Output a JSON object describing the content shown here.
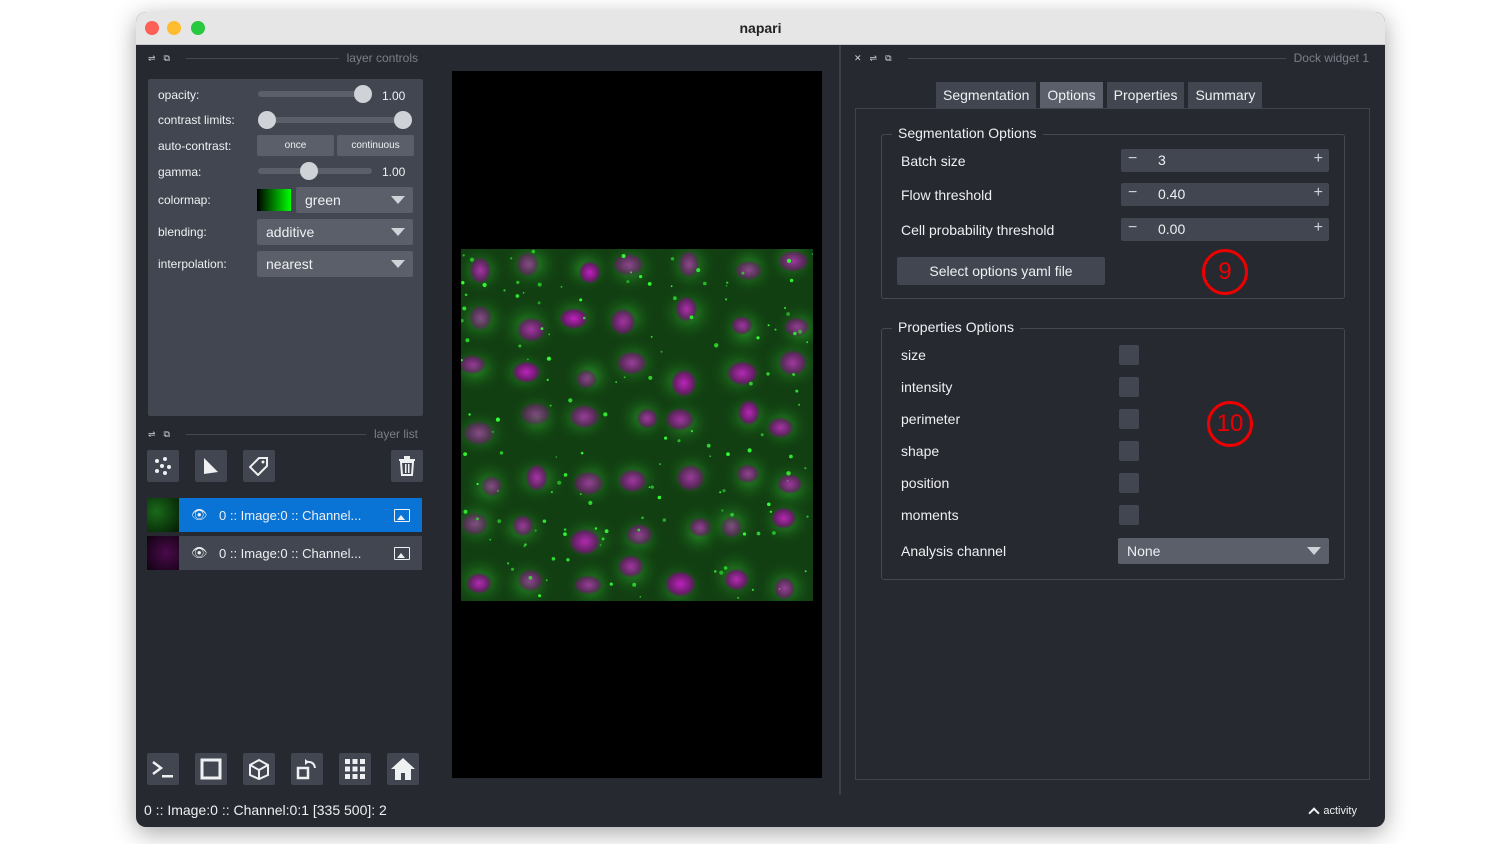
{
  "window": {
    "title": "napari"
  },
  "left_dock": {
    "header": "layer controls",
    "controls": {
      "opacity_label": "opacity:",
      "opacity_value": "1.00",
      "opacity_fraction": 1.0,
      "contrast_label": "contrast limits:",
      "auto_contrast_label": "auto-contrast:",
      "once_label": "once",
      "continuous_label": "continuous",
      "gamma_label": "gamma:",
      "gamma_value": "1.00",
      "colormap_label": "colormap:",
      "colormap_value": "green",
      "blending_label": "blending:",
      "blending_value": "additive",
      "interpolation_label": "interpolation:",
      "interpolation_value": "nearest"
    },
    "layer_list_header": "layer list",
    "layers": [
      {
        "name": "0 :: Image:0 :: Channel...",
        "selected": true,
        "thumb_color": "#00ff00"
      },
      {
        "name": "0 :: Image:0 :: Channel...",
        "selected": false,
        "thumb_color": "#ff00ff"
      }
    ]
  },
  "right_dock": {
    "header": "Dock widget 1",
    "tabs": [
      {
        "label": "Segmentation",
        "active": false
      },
      {
        "label": "Options",
        "active": true
      },
      {
        "label": "Properties",
        "active": false
      },
      {
        "label": "Summary",
        "active": false
      }
    ],
    "segmentation_options": {
      "title": "Segmentation Options",
      "batch_size_label": "Batch size",
      "batch_size_value": "3",
      "flow_threshold_label": "Flow threshold",
      "flow_threshold_value": "0.40",
      "cell_prob_label": "Cell probability threshold",
      "cell_prob_value": "0.00",
      "select_yaml_label": "Select options yaml file",
      "annotation_number": "9"
    },
    "properties_options": {
      "title": "Properties Options",
      "items": [
        "size",
        "intensity",
        "perimeter",
        "shape",
        "position",
        "moments"
      ],
      "analysis_channel_label": "Analysis channel",
      "analysis_channel_value": "None",
      "annotation_number": "10"
    }
  },
  "status_bar": {
    "text": "0 :: Image:0 :: Channel:0:1 [335 500]: 2",
    "activity_label": "activity"
  }
}
